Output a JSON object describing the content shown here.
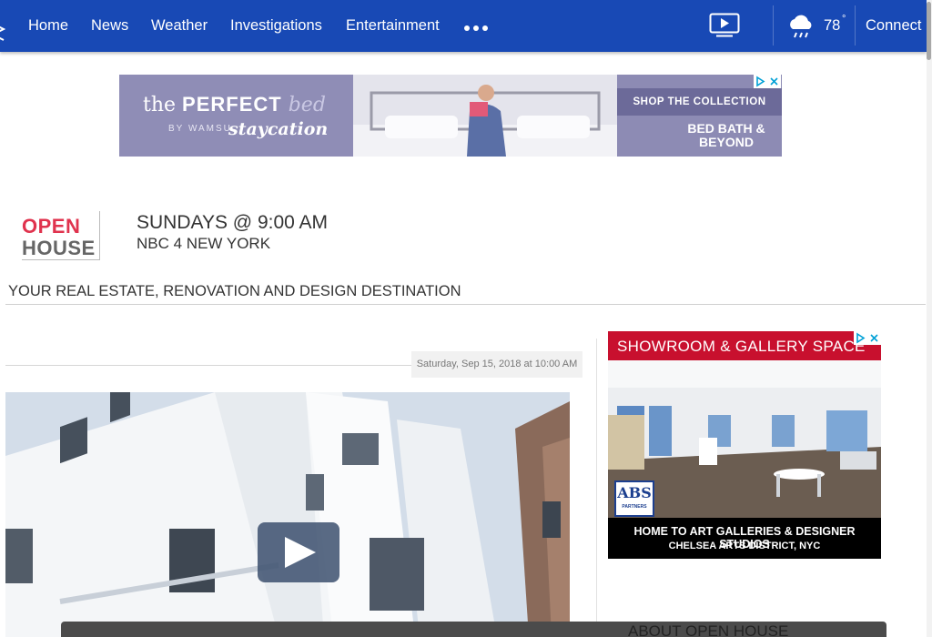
{
  "nav": {
    "links": [
      "Home",
      "News",
      "Weather",
      "Investigations",
      "Entertainment"
    ],
    "more_icon": "more-dots-icon",
    "video_icon": "video-player-icon",
    "weather_icon": "rain-cloud-icon",
    "temperature": "78",
    "degree": "°",
    "connect_label": "Connect",
    "bg_color": "#1849b5"
  },
  "top_ad": {
    "headline_a": "the",
    "headline_b": "PERFECT",
    "headline_c": "bed",
    "byline": "BY WAMSU",
    "collection": "staycation",
    "cta": "SHOP THE COLLECTION",
    "brand_line1": "BED BATH &",
    "brand_line2": "BEYOND",
    "ad_choices_icon": "ad-choices-icon",
    "close_icon": "close-icon"
  },
  "show": {
    "logo_open": "OPEN",
    "logo_house": "HOUSE",
    "time": "SUNDAYS @ 9:00 AM",
    "station": "NBC 4 NEW YORK",
    "tagline": "YOUR REAL ESTATE, RENOVATION AND DESIGN DESTINATION"
  },
  "article": {
    "date": "Saturday, Sep 15, 2018 at 10:00 AM",
    "play_icon": "play-icon"
  },
  "side_ad": {
    "headline": "SHOWROOM & GALLERY SPACE",
    "logo_text": "ABS",
    "logo_sub": "PARTNERS",
    "line1": "HOME TO ART GALLERIES & DESIGNER STUDIOS",
    "line2": "CHELSEA ARTS DISTRICT, NYC",
    "accent": "#c8102e"
  },
  "about": {
    "title": "ABOUT OPEN HOUSE"
  }
}
